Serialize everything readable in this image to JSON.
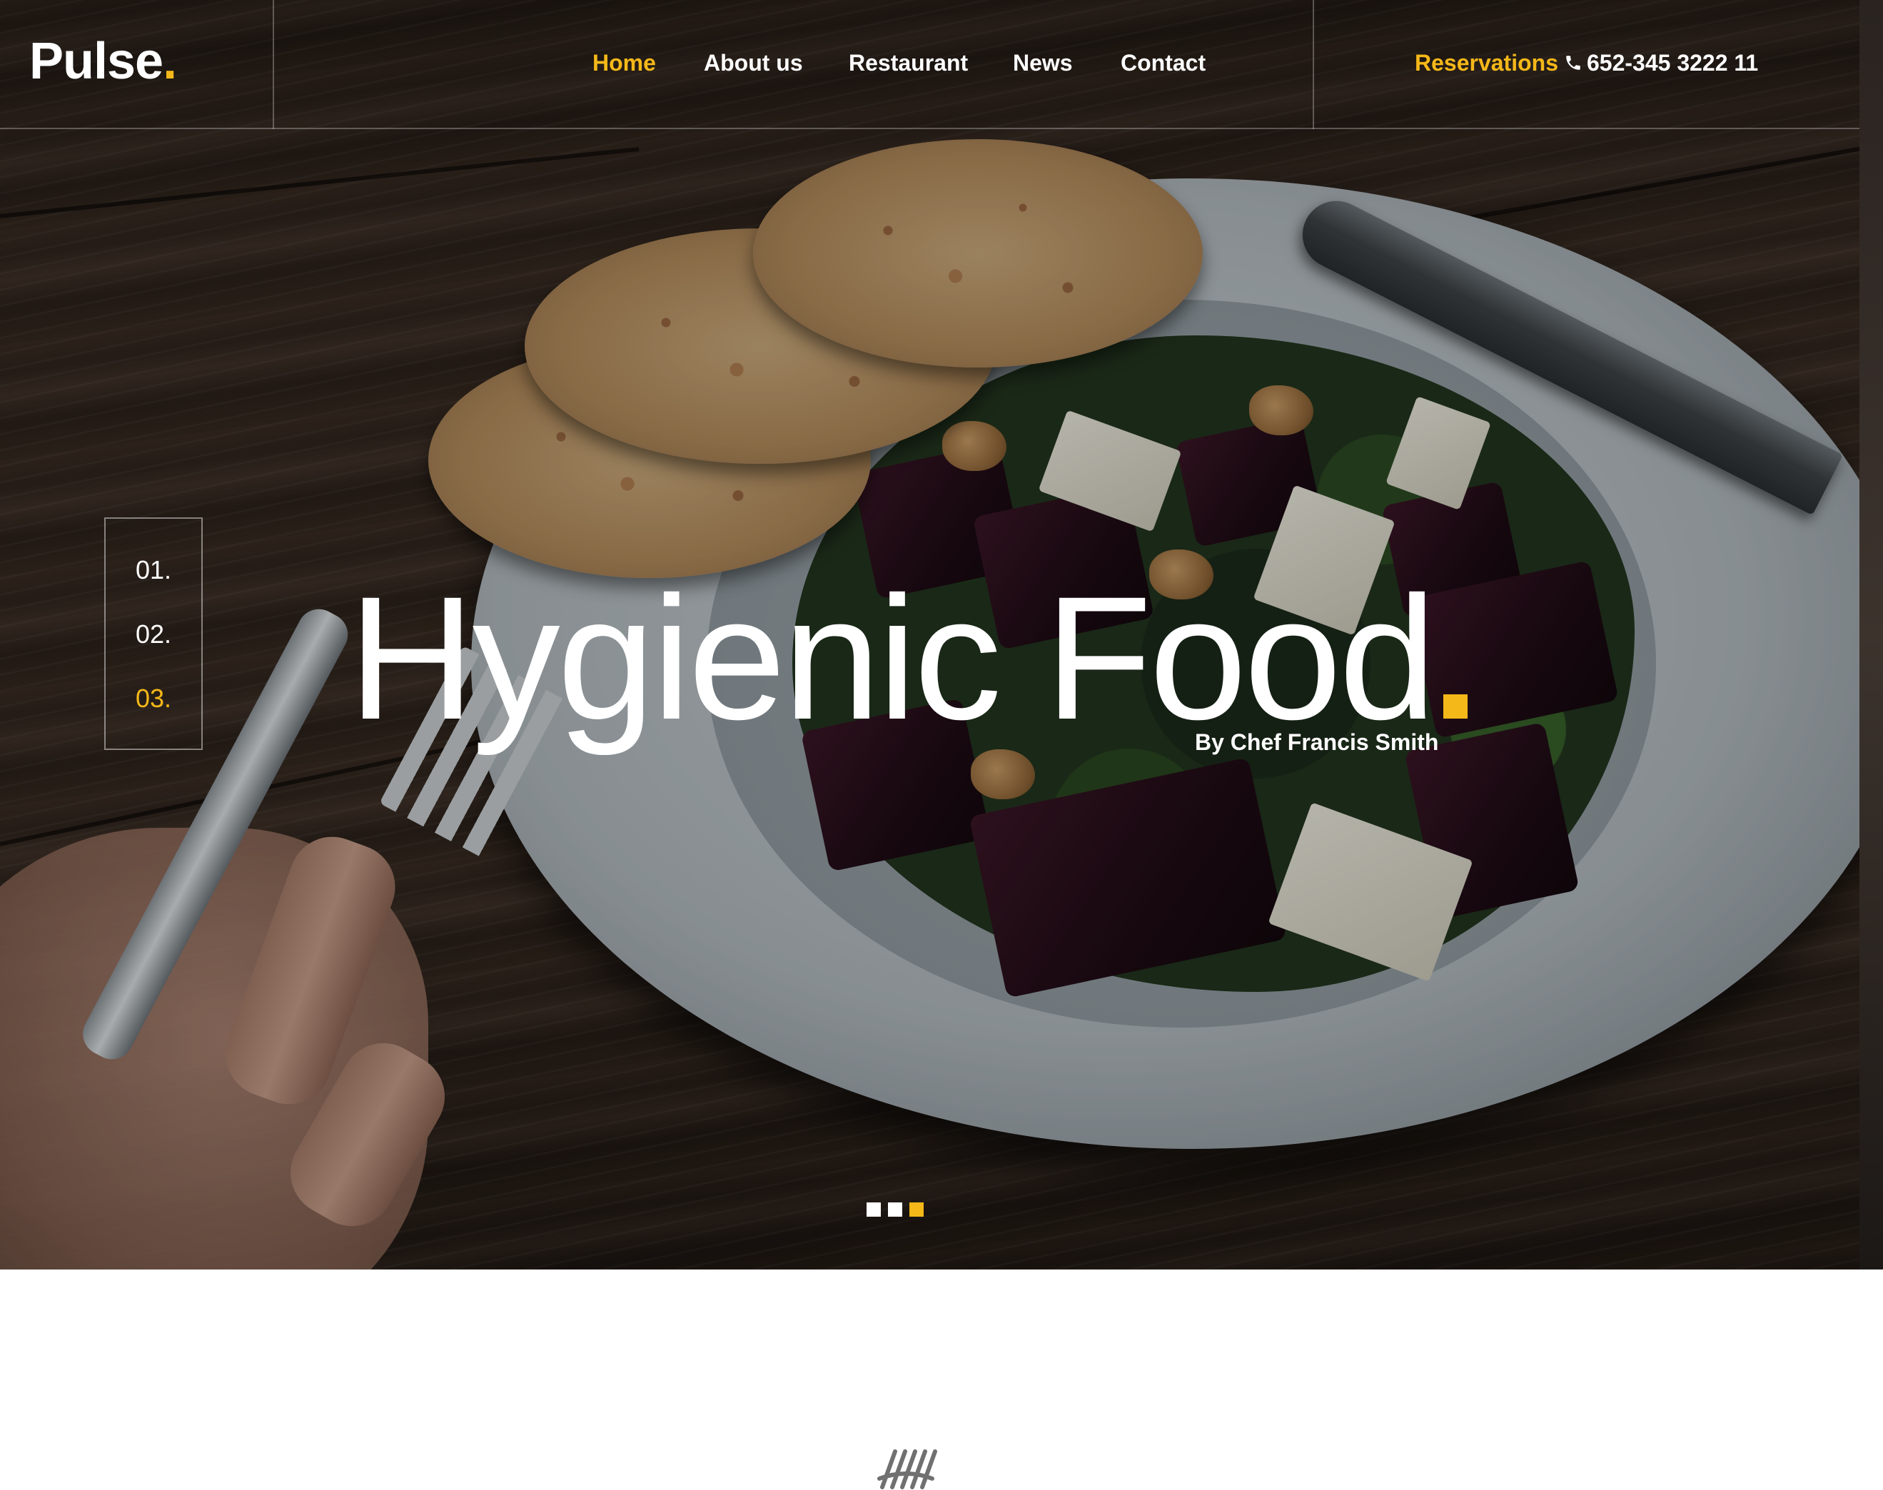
{
  "brand": {
    "name": "Pulse",
    "dot": ".",
    "accent_color": "#f5b819"
  },
  "nav": {
    "items": [
      {
        "label": "Home",
        "active": true
      },
      {
        "label": "About us",
        "active": false
      },
      {
        "label": "Restaurant",
        "active": false
      },
      {
        "label": "News",
        "active": false
      },
      {
        "label": "Contact",
        "active": false
      }
    ]
  },
  "reservations": {
    "label": "Reservations",
    "icon": "phone-icon",
    "phone": "652-345 3222 11"
  },
  "slider": {
    "numbers": [
      {
        "label": "01.",
        "active": false
      },
      {
        "label": "02.",
        "active": false
      },
      {
        "label": "03.",
        "active": true
      }
    ],
    "headline": "Hygienic Food",
    "byline": "By Chef Francis Smith",
    "dots": [
      {
        "active": false
      },
      {
        "active": false
      },
      {
        "active": true
      }
    ]
  },
  "section": {
    "icon": "fork-knife-icon"
  }
}
